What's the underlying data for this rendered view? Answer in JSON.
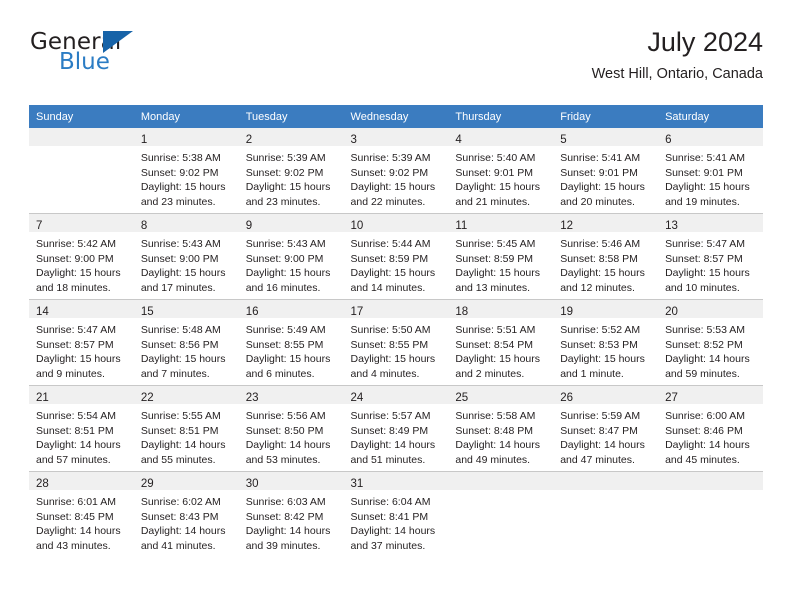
{
  "brand": {
    "name_top": "General",
    "name_bottom": "Blue",
    "accent_color": "#2b7cc4",
    "triangle_color": "#1763a8",
    "logo_icon": "blue-triangle-icon"
  },
  "header": {
    "title": "July 2024",
    "location": "West Hill, Ontario, Canada"
  },
  "calendar": {
    "header_bg": "#3b7cc0",
    "daynum_strip_bg": "#f0f0f0",
    "weekday_names": [
      "Sunday",
      "Monday",
      "Tuesday",
      "Wednesday",
      "Thursday",
      "Friday",
      "Saturday"
    ],
    "weeks": [
      [
        {
          "day": "",
          "sunrise": "",
          "sunset": "",
          "daylight_1": "",
          "daylight_2": ""
        },
        {
          "day": "1",
          "sunrise": "Sunrise: 5:38 AM",
          "sunset": "Sunset: 9:02 PM",
          "daylight_1": "Daylight: 15 hours",
          "daylight_2": "and 23 minutes."
        },
        {
          "day": "2",
          "sunrise": "Sunrise: 5:39 AM",
          "sunset": "Sunset: 9:02 PM",
          "daylight_1": "Daylight: 15 hours",
          "daylight_2": "and 23 minutes."
        },
        {
          "day": "3",
          "sunrise": "Sunrise: 5:39 AM",
          "sunset": "Sunset: 9:02 PM",
          "daylight_1": "Daylight: 15 hours",
          "daylight_2": "and 22 minutes."
        },
        {
          "day": "4",
          "sunrise": "Sunrise: 5:40 AM",
          "sunset": "Sunset: 9:01 PM",
          "daylight_1": "Daylight: 15 hours",
          "daylight_2": "and 21 minutes."
        },
        {
          "day": "5",
          "sunrise": "Sunrise: 5:41 AM",
          "sunset": "Sunset: 9:01 PM",
          "daylight_1": "Daylight: 15 hours",
          "daylight_2": "and 20 minutes."
        },
        {
          "day": "6",
          "sunrise": "Sunrise: 5:41 AM",
          "sunset": "Sunset: 9:01 PM",
          "daylight_1": "Daylight: 15 hours",
          "daylight_2": "and 19 minutes."
        }
      ],
      [
        {
          "day": "7",
          "sunrise": "Sunrise: 5:42 AM",
          "sunset": "Sunset: 9:00 PM",
          "daylight_1": "Daylight: 15 hours",
          "daylight_2": "and 18 minutes."
        },
        {
          "day": "8",
          "sunrise": "Sunrise: 5:43 AM",
          "sunset": "Sunset: 9:00 PM",
          "daylight_1": "Daylight: 15 hours",
          "daylight_2": "and 17 minutes."
        },
        {
          "day": "9",
          "sunrise": "Sunrise: 5:43 AM",
          "sunset": "Sunset: 9:00 PM",
          "daylight_1": "Daylight: 15 hours",
          "daylight_2": "and 16 minutes."
        },
        {
          "day": "10",
          "sunrise": "Sunrise: 5:44 AM",
          "sunset": "Sunset: 8:59 PM",
          "daylight_1": "Daylight: 15 hours",
          "daylight_2": "and 14 minutes."
        },
        {
          "day": "11",
          "sunrise": "Sunrise: 5:45 AM",
          "sunset": "Sunset: 8:59 PM",
          "daylight_1": "Daylight: 15 hours",
          "daylight_2": "and 13 minutes."
        },
        {
          "day": "12",
          "sunrise": "Sunrise: 5:46 AM",
          "sunset": "Sunset: 8:58 PM",
          "daylight_1": "Daylight: 15 hours",
          "daylight_2": "and 12 minutes."
        },
        {
          "day": "13",
          "sunrise": "Sunrise: 5:47 AM",
          "sunset": "Sunset: 8:57 PM",
          "daylight_1": "Daylight: 15 hours",
          "daylight_2": "and 10 minutes."
        }
      ],
      [
        {
          "day": "14",
          "sunrise": "Sunrise: 5:47 AM",
          "sunset": "Sunset: 8:57 PM",
          "daylight_1": "Daylight: 15 hours",
          "daylight_2": "and 9 minutes."
        },
        {
          "day": "15",
          "sunrise": "Sunrise: 5:48 AM",
          "sunset": "Sunset: 8:56 PM",
          "daylight_1": "Daylight: 15 hours",
          "daylight_2": "and 7 minutes."
        },
        {
          "day": "16",
          "sunrise": "Sunrise: 5:49 AM",
          "sunset": "Sunset: 8:55 PM",
          "daylight_1": "Daylight: 15 hours",
          "daylight_2": "and 6 minutes."
        },
        {
          "day": "17",
          "sunrise": "Sunrise: 5:50 AM",
          "sunset": "Sunset: 8:55 PM",
          "daylight_1": "Daylight: 15 hours",
          "daylight_2": "and 4 minutes."
        },
        {
          "day": "18",
          "sunrise": "Sunrise: 5:51 AM",
          "sunset": "Sunset: 8:54 PM",
          "daylight_1": "Daylight: 15 hours",
          "daylight_2": "and 2 minutes."
        },
        {
          "day": "19",
          "sunrise": "Sunrise: 5:52 AM",
          "sunset": "Sunset: 8:53 PM",
          "daylight_1": "Daylight: 15 hours",
          "daylight_2": "and 1 minute."
        },
        {
          "day": "20",
          "sunrise": "Sunrise: 5:53 AM",
          "sunset": "Sunset: 8:52 PM",
          "daylight_1": "Daylight: 14 hours",
          "daylight_2": "and 59 minutes."
        }
      ],
      [
        {
          "day": "21",
          "sunrise": "Sunrise: 5:54 AM",
          "sunset": "Sunset: 8:51 PM",
          "daylight_1": "Daylight: 14 hours",
          "daylight_2": "and 57 minutes."
        },
        {
          "day": "22",
          "sunrise": "Sunrise: 5:55 AM",
          "sunset": "Sunset: 8:51 PM",
          "daylight_1": "Daylight: 14 hours",
          "daylight_2": "and 55 minutes."
        },
        {
          "day": "23",
          "sunrise": "Sunrise: 5:56 AM",
          "sunset": "Sunset: 8:50 PM",
          "daylight_1": "Daylight: 14 hours",
          "daylight_2": "and 53 minutes."
        },
        {
          "day": "24",
          "sunrise": "Sunrise: 5:57 AM",
          "sunset": "Sunset: 8:49 PM",
          "daylight_1": "Daylight: 14 hours",
          "daylight_2": "and 51 minutes."
        },
        {
          "day": "25",
          "sunrise": "Sunrise: 5:58 AM",
          "sunset": "Sunset: 8:48 PM",
          "daylight_1": "Daylight: 14 hours",
          "daylight_2": "and 49 minutes."
        },
        {
          "day": "26",
          "sunrise": "Sunrise: 5:59 AM",
          "sunset": "Sunset: 8:47 PM",
          "daylight_1": "Daylight: 14 hours",
          "daylight_2": "and 47 minutes."
        },
        {
          "day": "27",
          "sunrise": "Sunrise: 6:00 AM",
          "sunset": "Sunset: 8:46 PM",
          "daylight_1": "Daylight: 14 hours",
          "daylight_2": "and 45 minutes."
        }
      ],
      [
        {
          "day": "28",
          "sunrise": "Sunrise: 6:01 AM",
          "sunset": "Sunset: 8:45 PM",
          "daylight_1": "Daylight: 14 hours",
          "daylight_2": "and 43 minutes."
        },
        {
          "day": "29",
          "sunrise": "Sunrise: 6:02 AM",
          "sunset": "Sunset: 8:43 PM",
          "daylight_1": "Daylight: 14 hours",
          "daylight_2": "and 41 minutes."
        },
        {
          "day": "30",
          "sunrise": "Sunrise: 6:03 AM",
          "sunset": "Sunset: 8:42 PM",
          "daylight_1": "Daylight: 14 hours",
          "daylight_2": "and 39 minutes."
        },
        {
          "day": "31",
          "sunrise": "Sunrise: 6:04 AM",
          "sunset": "Sunset: 8:41 PM",
          "daylight_1": "Daylight: 14 hours",
          "daylight_2": "and 37 minutes."
        },
        {
          "day": "",
          "sunrise": "",
          "sunset": "",
          "daylight_1": "",
          "daylight_2": ""
        },
        {
          "day": "",
          "sunrise": "",
          "sunset": "",
          "daylight_1": "",
          "daylight_2": ""
        },
        {
          "day": "",
          "sunrise": "",
          "sunset": "",
          "daylight_1": "",
          "daylight_2": ""
        }
      ]
    ]
  }
}
